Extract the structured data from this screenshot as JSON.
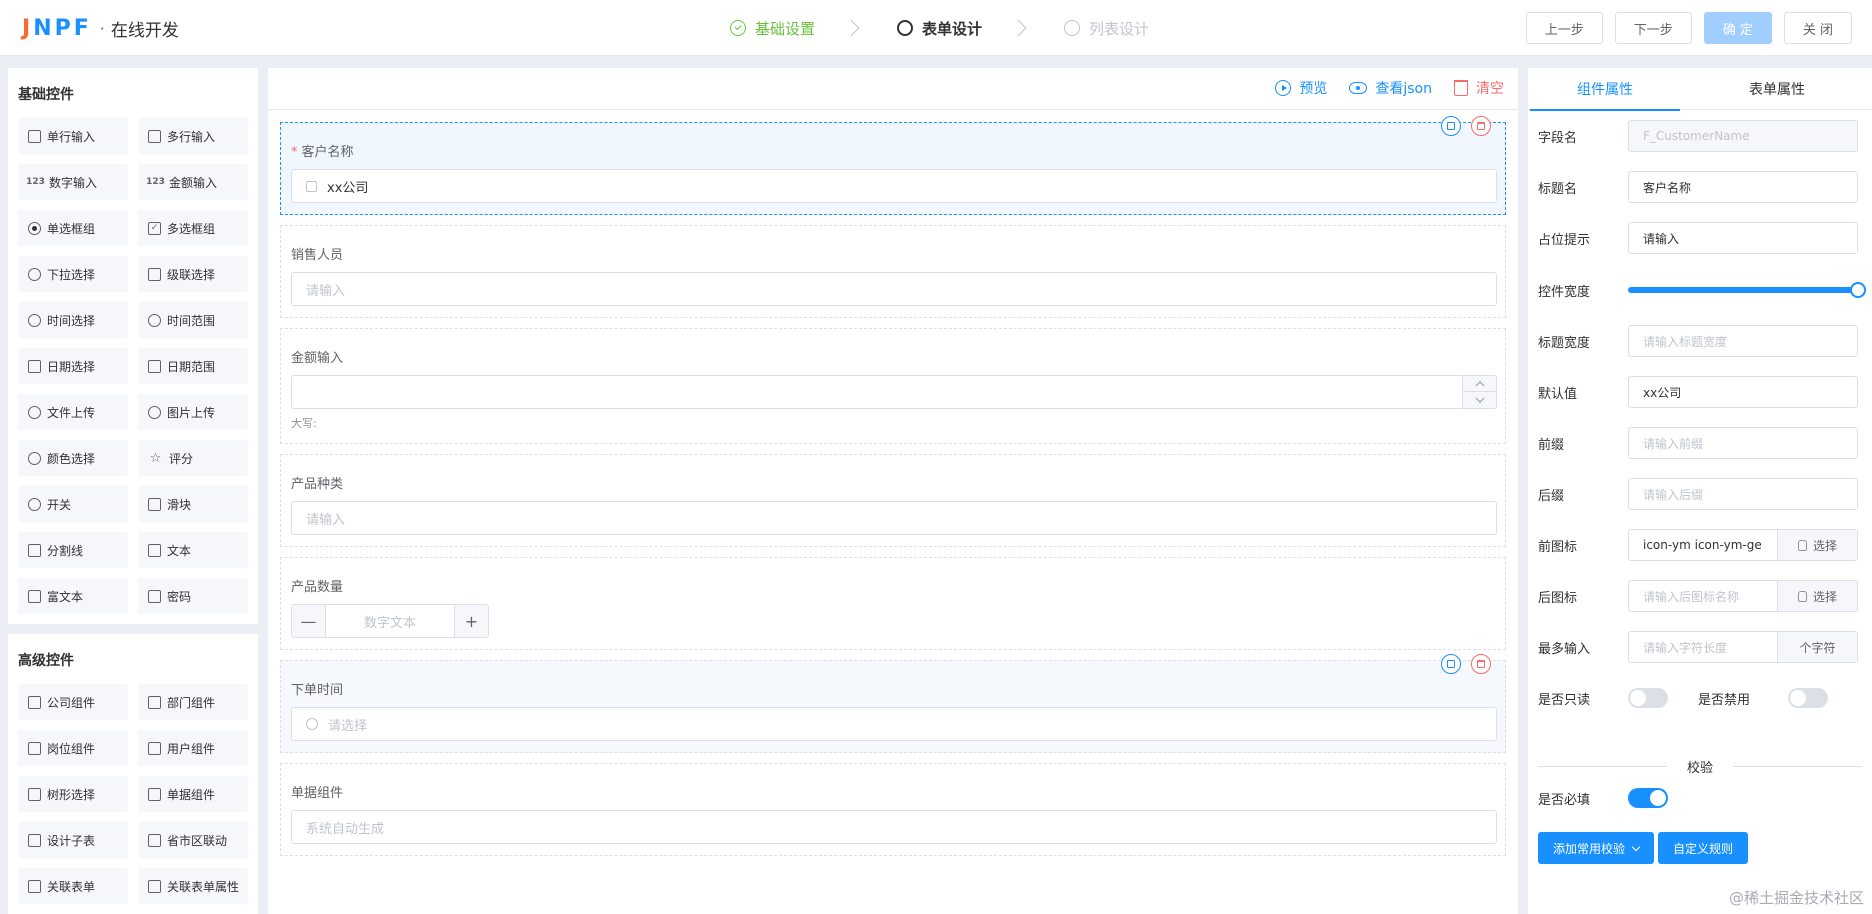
{
  "header": {
    "logo_mark": "JNPF",
    "logo_sep": "·",
    "logo_text": "在线开发",
    "steps": [
      {
        "label": "基础设置",
        "state": "done"
      },
      {
        "label": "表单设计",
        "state": "active"
      },
      {
        "label": "列表设计",
        "state": "todo"
      }
    ],
    "buttons": {
      "prev": "上一步",
      "next": "下一步",
      "confirm": "确 定",
      "close": "关 闭"
    }
  },
  "left": {
    "basic": {
      "title": "基础控件",
      "items": [
        {
          "label": "单行输入",
          "icon": "single-line-input-icon"
        },
        {
          "label": "多行输入",
          "icon": "multi-line-input-icon"
        },
        {
          "label": "数字输入",
          "icon": "number-icon"
        },
        {
          "label": "金额输入",
          "icon": "amount-icon"
        },
        {
          "label": "单选框组",
          "icon": "radio-icon"
        },
        {
          "label": "多选框组",
          "icon": "checkbox-icon"
        },
        {
          "label": "下拉选择",
          "icon": "select-icon"
        },
        {
          "label": "级联选择",
          "icon": "cascader-icon"
        },
        {
          "label": "时间选择",
          "icon": "clock-icon"
        },
        {
          "label": "时间范围",
          "icon": "time-range-icon"
        },
        {
          "label": "日期选择",
          "icon": "calendar-icon"
        },
        {
          "label": "日期范围",
          "icon": "date-range-icon"
        },
        {
          "label": "文件上传",
          "icon": "upload-icon"
        },
        {
          "label": "图片上传",
          "icon": "image-upload-icon"
        },
        {
          "label": "颜色选择",
          "icon": "palette-icon"
        },
        {
          "label": "评分",
          "icon": "star-icon"
        },
        {
          "label": "开关",
          "icon": "toggle-icon"
        },
        {
          "label": "滑块",
          "icon": "slider-icon"
        },
        {
          "label": "分割线",
          "icon": "divider-icon"
        },
        {
          "label": "文本",
          "icon": "text-icon"
        },
        {
          "label": "富文本",
          "icon": "rich-text-icon"
        },
        {
          "label": "密码",
          "icon": "lock-icon"
        }
      ]
    },
    "advanced": {
      "title": "高级控件",
      "items": [
        {
          "label": "公司组件",
          "icon": "company-icon"
        },
        {
          "label": "部门组件",
          "icon": "department-icon"
        },
        {
          "label": "岗位组件",
          "icon": "position-icon"
        },
        {
          "label": "用户组件",
          "icon": "user-icon"
        },
        {
          "label": "树形选择",
          "icon": "tree-icon"
        },
        {
          "label": "单据组件",
          "icon": "document-icon"
        },
        {
          "label": "设计子表",
          "icon": "table-icon"
        },
        {
          "label": "省市区联动",
          "icon": "location-icon"
        },
        {
          "label": "关联表单",
          "icon": "link-form-icon"
        },
        {
          "label": "关联表单属性",
          "icon": "link-form-attr-icon"
        }
      ]
    }
  },
  "canvas": {
    "toolbar": {
      "preview": "预览",
      "view_json": "查看json",
      "clear": "清空"
    },
    "fields": {
      "customer": {
        "label": "客户名称",
        "value": "xx公司"
      },
      "sales": {
        "label": "销售人员",
        "placeholder": "请输入"
      },
      "amount": {
        "label": "金额输入",
        "hint": "大写:"
      },
      "category": {
        "label": "产品种类",
        "placeholder": "请输入"
      },
      "quantity": {
        "label": "产品数量",
        "placeholder": "数字文本",
        "minus": "—",
        "plus": "+"
      },
      "order_time": {
        "label": "下单时间",
        "placeholder": "请选择"
      },
      "doc_no": {
        "label": "单据组件",
        "placeholder": "系统自动生成"
      }
    }
  },
  "right": {
    "tabs": {
      "component": "组件属性",
      "form": "表单属性"
    },
    "props": {
      "field_name": {
        "label": "字段名",
        "value": "F_CustomerName"
      },
      "title_name": {
        "label": "标题名",
        "value": "客户名称"
      },
      "placeholder": {
        "label": "占位提示",
        "value": "请输入"
      },
      "width": {
        "label": "控件宽度",
        "value_percent": 100
      },
      "title_width": {
        "label": "标题宽度",
        "placeholder": "请输入标题宽度"
      },
      "default": {
        "label": "默认值",
        "value": "xx公司"
      },
      "prefix": {
        "label": "前缀",
        "placeholder": "请输入前缀"
      },
      "suffix": {
        "label": "后缀",
        "placeholder": "请输入后缀"
      },
      "prefix_icon": {
        "label": "前图标",
        "value": "icon-ym icon-ym-ge",
        "button": "选择"
      },
      "suffix_icon": {
        "label": "后图标",
        "placeholder": "请输入后图标名称",
        "button": "选择"
      },
      "max_input": {
        "label": "最多输入",
        "placeholder": "请输入字符长度",
        "unit": "个字符"
      },
      "readonly": {
        "label": "是否只读",
        "on": false
      },
      "disabled": {
        "label": "是否禁用",
        "on": false
      },
      "validation_title": "校验",
      "required": {
        "label": "是否必填",
        "on": true
      }
    },
    "buttons": {
      "add_rule": "添加常用校验",
      "custom_rule": "自定义规则"
    }
  },
  "watermark": "@稀土掘金技术社区",
  "colors": {
    "primary": "#1890ff",
    "success": "#67c23a",
    "danger": "#f56c6c",
    "muted": "#c0c4cc"
  }
}
